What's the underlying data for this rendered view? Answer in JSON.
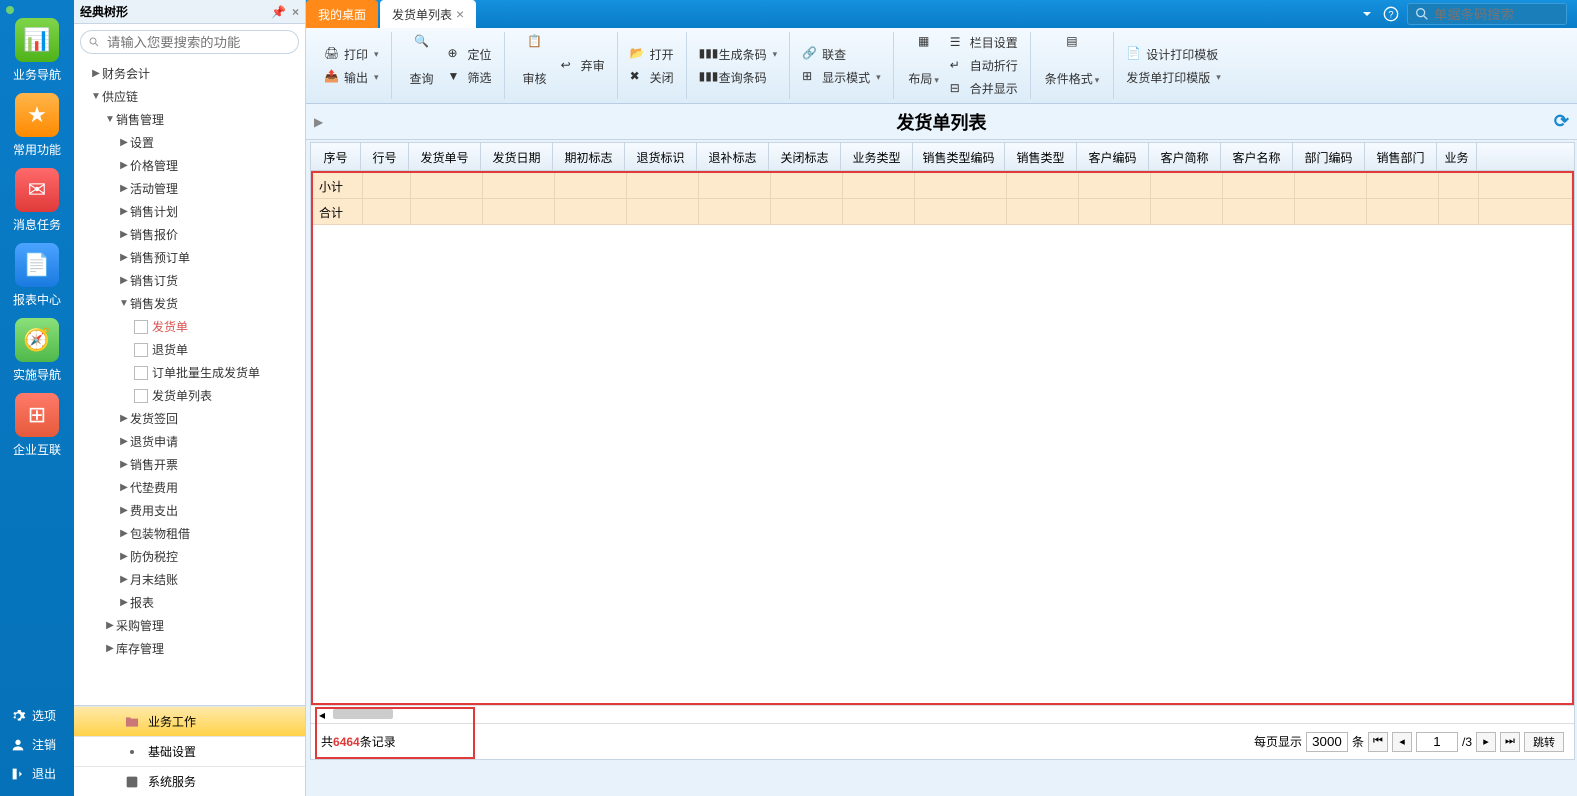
{
  "nav_rail": {
    "items": [
      {
        "label": "业务导航"
      },
      {
        "label": "常用功能"
      },
      {
        "label": "消息任务"
      },
      {
        "label": "报表中心"
      },
      {
        "label": "实施导航"
      },
      {
        "label": "企业互联"
      }
    ],
    "bottom": [
      {
        "label": "选项"
      },
      {
        "label": "注销"
      },
      {
        "label": "退出"
      }
    ]
  },
  "tree": {
    "title": "经典树形",
    "search_placeholder": "请输入您要搜索的功能",
    "nodes": {
      "caiwu": "财务会计",
      "gongying": "供应链",
      "xiaoshou": "销售管理",
      "shezhi": "设置",
      "jiage": "价格管理",
      "huodong": "活动管理",
      "jihua": "销售计划",
      "baojia": "销售报价",
      "yuding": "销售预订单",
      "dinghuo": "销售订货",
      "fahuo": "销售发货",
      "fahuodan": "发货单",
      "tuihuo": "退货单",
      "piliang": "订单批量生成发货单",
      "fahuoliebiao": "发货单列表",
      "qianhui": "发货签回",
      "tuihuosq": "退货申请",
      "kaipiao": "销售开票",
      "daidian": "代垫费用",
      "feiyong": "费用支出",
      "baozhuang": "包装物租借",
      "fangwei": "防伪税控",
      "yuemo": "月末结账",
      "baobiao": "报表",
      "caigou": "采购管理",
      "kucun": "库存管理"
    },
    "bottom": {
      "yewu": "业务工作",
      "jichu": "基础设置",
      "xitong": "系统服务"
    }
  },
  "tabs": {
    "desktop": "我的桌面",
    "current": "发货单列表"
  },
  "search_placeholder": "单据条码搜索",
  "ribbon": {
    "print": "打印",
    "export": "输出",
    "query": "查询",
    "locate": "定位",
    "filter": "筛选",
    "review": "审核",
    "abandon": "弃审",
    "open": "打开",
    "close": "关闭",
    "gen_barcode": "生成条码",
    "query_barcode": "查询条码",
    "lookup": "联查",
    "display_mode": "显示模式",
    "layout": "布局",
    "col_setting": "栏目设置",
    "auto_wrap": "自动折行",
    "merge_show": "合并显示",
    "cond_format": "条件格式",
    "print_template": "设计打印模板",
    "print_template2": "发货单打印模版"
  },
  "sheet": {
    "title": "发货单列表"
  },
  "columns": [
    "序号",
    "行号",
    "发货单号",
    "发货日期",
    "期初标志",
    "退货标识",
    "退补标志",
    "关闭标志",
    "业务类型",
    "销售类型编码",
    "销售类型",
    "客户编码",
    "客户简称",
    "客户名称",
    "部门编码",
    "销售部门",
    "业务"
  ],
  "rows": {
    "subtotal": "小计",
    "total": "合计"
  },
  "footer": {
    "prefix": "共",
    "count": "6464",
    "suffix": "条记录",
    "per_page_label": "每页显示",
    "per_page_value": "3000",
    "per_page_unit": "条",
    "page_value": "1",
    "page_total": "/3",
    "jump": "跳转"
  }
}
